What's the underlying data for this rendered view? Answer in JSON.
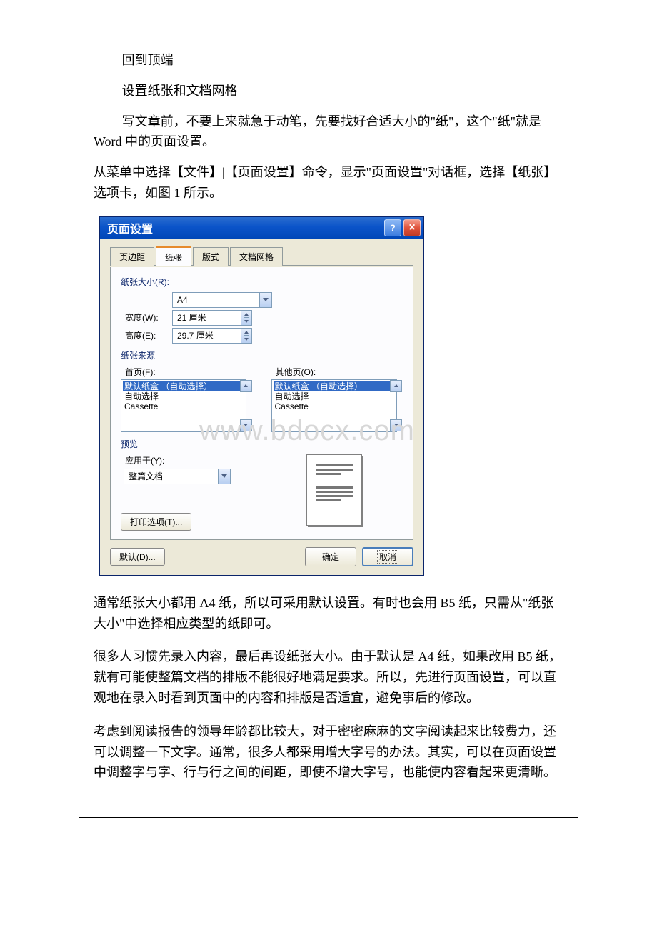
{
  "intro": {
    "back_to_top": "回到顶端",
    "section_heading": "设置纸张和文档网格",
    "line1": "写文章前，不要上来就急于动笔，先要找好合适大小的\"纸\"，这个\"纸\"就是 Word 中的页面设置。",
    "line2": "从菜单中选择【文件】|【页面设置】命令，显示\"页面设置\"对话框，选择【纸张】选项卡，如图 1 所示。"
  },
  "dialog": {
    "title": "页面设置",
    "tabs": {
      "margins": "页边距",
      "paper": "纸张",
      "layout": "版式",
      "grid": "文档网格"
    },
    "paper_size_label": "纸张大小(R):",
    "paper_size_value": "A4",
    "width_label": "宽度(W):",
    "width_value": "21 厘米",
    "height_label": "高度(E):",
    "height_value": "29.7 厘米",
    "paper_source_label": "纸张来源",
    "first_page_label": "首页(F):",
    "other_pages_label": "其他页(O):",
    "source_items": {
      "default_tray": "默认纸盒 （自动选择）",
      "auto_select": "自动选择",
      "cassette": "Cassette"
    },
    "preview_label": "预览",
    "apply_to_label": "应用于(Y):",
    "apply_to_value": "整篇文档",
    "print_options_btn": "打印选项(T)...",
    "default_btn": "默认(D)...",
    "ok_btn": "确定",
    "cancel_btn": "取消"
  },
  "watermark": "www.bdocx.com",
  "after": {
    "p1": "通常纸张大小都用 A4 纸，所以可采用默认设置。有时也会用 B5 纸，只需从\"纸张大小\"中选择相应类型的纸即可。",
    "p2": "很多人习惯先录入内容，最后再设纸张大小。由于默认是 A4 纸，如果改用 B5 纸，就有可能使整篇文档的排版不能很好地满足要求。所以，先进行页面设置，可以直观地在录入时看到页面中的内容和排版是否适宜，避免事后的修改。",
    "p3": "考虑到阅读报告的领导年龄都比较大，对于密密麻麻的文字阅读起来比较费力，还可以调整一下文字。通常，很多人都采用增大字号的办法。其实，可以在页面设置中调整字与字、行与行之间的间距，即使不增大字号，也能使内容看起来更清晰。"
  }
}
